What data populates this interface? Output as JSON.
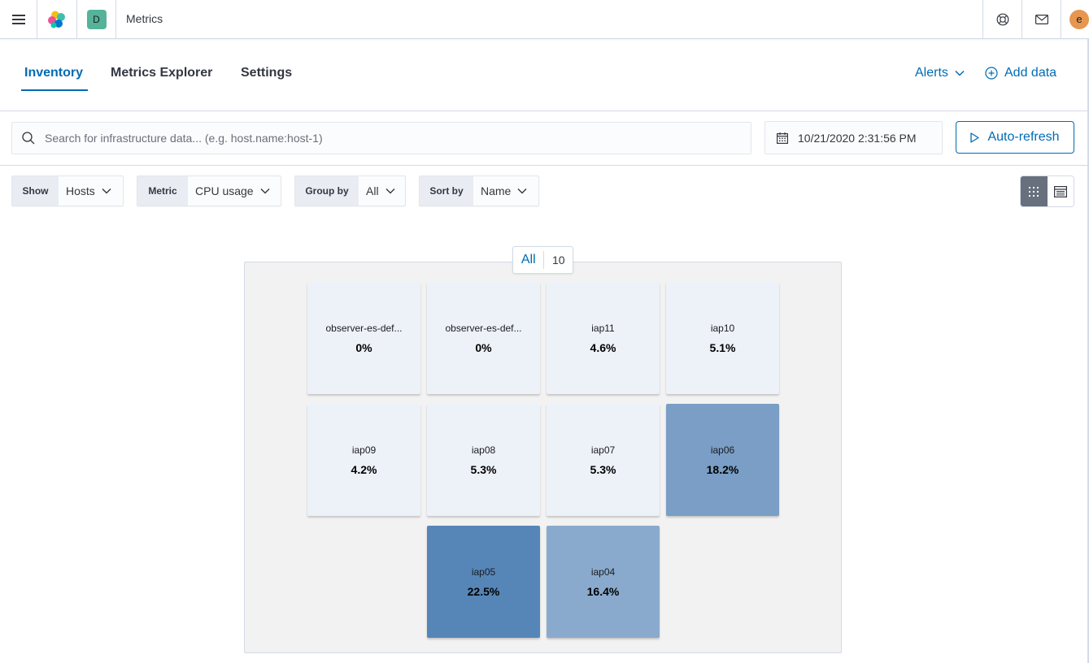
{
  "header": {
    "space_initial": "D",
    "app_title": "Metrics",
    "user_initial": "e"
  },
  "tabs": [
    {
      "label": "Inventory",
      "active": true
    },
    {
      "label": "Metrics Explorer",
      "active": false
    },
    {
      "label": "Settings",
      "active": false
    }
  ],
  "header_actions": {
    "alerts_label": "Alerts",
    "add_data_label": "Add data"
  },
  "search": {
    "placeholder": "Search for infrastructure data... (e.g. host.name:host-1)",
    "value": ""
  },
  "date_picker": {
    "value": "10/21/2020 2:31:56 PM"
  },
  "auto_refresh_label": "Auto-refresh",
  "filters": {
    "show": {
      "label": "Show",
      "value": "Hosts"
    },
    "metric": {
      "label": "Metric",
      "value": "CPU usage"
    },
    "group_by": {
      "label": "Group by",
      "value": "All"
    },
    "sort_by": {
      "label": "Sort by",
      "value": "Name"
    }
  },
  "view_mode": "map",
  "group": {
    "name": "All",
    "count": "10"
  },
  "nodes": [
    {
      "name": "observer-es-def...",
      "value": "0%",
      "color": "#edf1f8"
    },
    {
      "name": "observer-es-def...",
      "value": "0%",
      "color": "#edf1f8"
    },
    {
      "name": "iap11",
      "value": "4.6%",
      "color": "#edf1f8"
    },
    {
      "name": "iap10",
      "value": "5.1%",
      "color": "#edf1f8"
    },
    {
      "name": "iap09",
      "value": "4.2%",
      "color": "#edf1f8"
    },
    {
      "name": "iap08",
      "value": "5.3%",
      "color": "#edf1f8"
    },
    {
      "name": "iap07",
      "value": "5.3%",
      "color": "#edf1f8"
    },
    {
      "name": "iap06",
      "value": "18.2%",
      "color": "#7a9ec5"
    },
    {
      "name": "iap05",
      "value": "22.5%",
      "color": "#5686b8"
    },
    {
      "name": "iap04",
      "value": "16.4%",
      "color": "#8aaacd"
    }
  ],
  "colors": {
    "accent": "#006bb4",
    "space_badge": "#54b399",
    "avatar": "#e7964f"
  }
}
